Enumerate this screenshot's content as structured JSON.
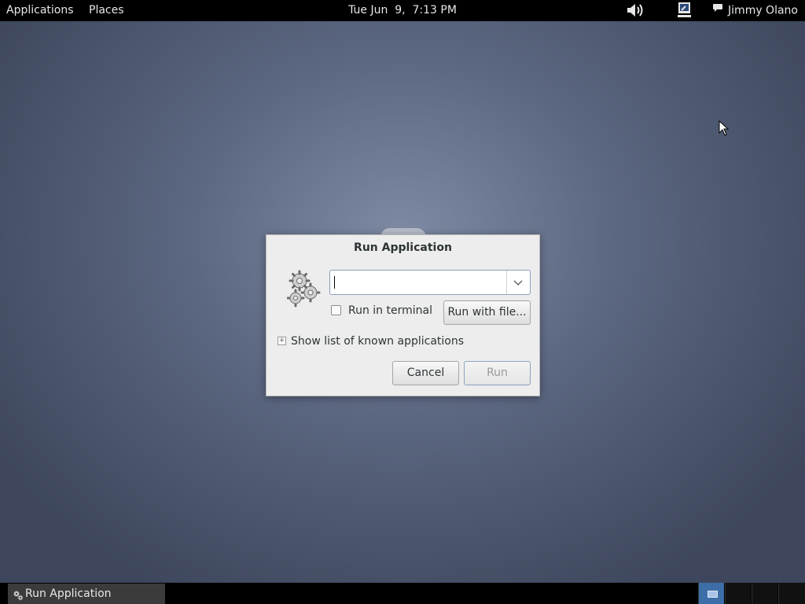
{
  "top_panel": {
    "applications_label": "Applications",
    "places_label": "Places",
    "clock": "Tue Jun  9,  7:13 PM",
    "user_name": "Jimmy Olano"
  },
  "dialog": {
    "title": "Run Application",
    "command_value": "",
    "run_in_terminal_label": "Run in terminal",
    "run_in_terminal_checked": false,
    "run_with_file_label": "Run with file...",
    "show_list_label": "Show list of known applications",
    "cancel_label": "Cancel",
    "run_label": "Run",
    "run_enabled": false
  },
  "bottom_panel": {
    "task_label": "Run Application",
    "workspaces": 4,
    "active_workspace": 1
  },
  "icons": {
    "dialog": "gears-icon",
    "volume": "speaker-volume-icon",
    "network": "network-wired-icon",
    "chat": "speech-bubble-icon"
  },
  "colors": {
    "panel": "#000000",
    "desktop": "#5b6680",
    "active_workspace": "#3d6ea8",
    "focus_border": "#8aa0bd"
  }
}
